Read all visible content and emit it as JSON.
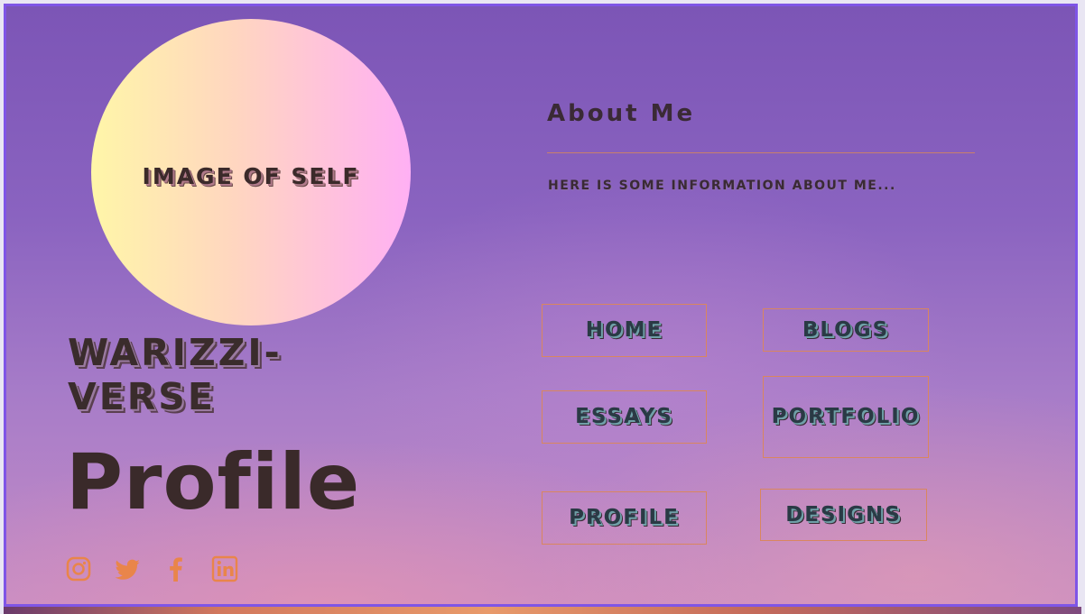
{
  "profile": {
    "image_placeholder": "IMAGE OF SELF",
    "site_name": "WARIZZI-VERSE",
    "page_title": "Profile"
  },
  "about": {
    "title": "About Me",
    "text": "Here is some information about me..."
  },
  "nav": {
    "home": "HOME",
    "blogs": "BLOGS",
    "essays": "ESSAYS",
    "portfolio": "PORTFOLIO",
    "profile": "PROFILE",
    "designs": "DESIGNS"
  },
  "social": [
    "instagram-icon",
    "twitter-icon",
    "facebook-icon",
    "linkedin-icon"
  ],
  "colors": {
    "accent": "#e9854a",
    "frame_border": "#7f55e6",
    "text_dark": "#3a2a2a"
  }
}
